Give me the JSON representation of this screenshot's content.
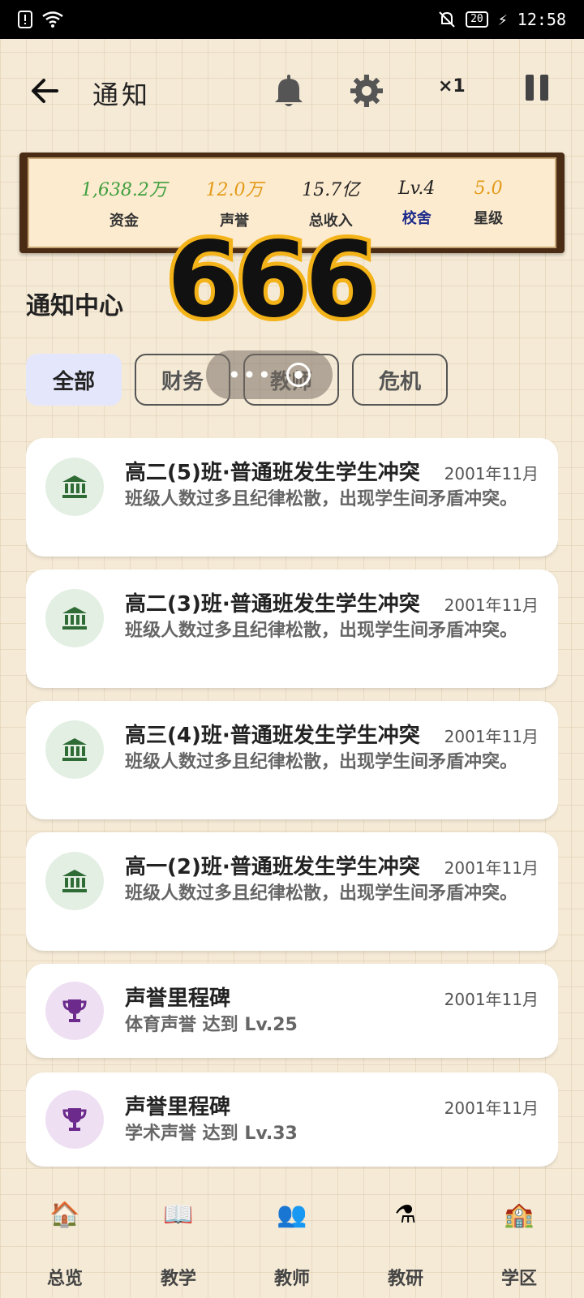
{
  "status_bar": {
    "time": "12:58",
    "battery": "20"
  },
  "app_bar": {
    "title": "通知",
    "speed": "×1"
  },
  "stats": [
    {
      "value": "1,638.2万",
      "label": "资金",
      "value_color": "#3e9f3e",
      "label_color": "#333333"
    },
    {
      "value": "12.0万",
      "label": "声誉",
      "value_color": "#e39a17",
      "label_color": "#333333"
    },
    {
      "value": "15.7亿",
      "label": "总收入",
      "value_color": "#222222",
      "label_color": "#333333"
    },
    {
      "value": "Lv.4",
      "label": "校舍",
      "value_color": "#222222",
      "label_color": "#1b2a8a"
    },
    {
      "value": "5.0",
      "label": "星级",
      "value_color": "#e39a17",
      "label_color": "#333333"
    }
  ],
  "overlay_number": "666",
  "section_title": "通知中心",
  "filters": [
    "全部",
    "财务",
    "教师",
    "危机"
  ],
  "notifications": [
    {
      "icon": "bank-icon",
      "title": "高二(5)班·普通班发生学生冲突",
      "date": "2001年11月",
      "desc": "班级人数过多且纪律松散，出现学生间矛盾冲突。"
    },
    {
      "icon": "bank-icon",
      "title": "高二(3)班·普通班发生学生冲突",
      "date": "2001年11月",
      "desc": "班级人数过多且纪律松散，出现学生间矛盾冲突。"
    },
    {
      "icon": "bank-icon",
      "title": "高三(4)班·普通班发生学生冲突",
      "date": "2001年11月",
      "desc": "班级人数过多且纪律松散，出现学生间矛盾冲突。"
    },
    {
      "icon": "bank-icon",
      "title": "高一(2)班·普通班发生学生冲突",
      "date": "2001年11月",
      "desc": "班级人数过多且纪律松散，出现学生间矛盾冲突。"
    },
    {
      "icon": "trophy-icon",
      "title": "声誉里程碑",
      "date": "2001年11月",
      "desc": "体育声誉 达到 Lv.25"
    },
    {
      "icon": "trophy-icon",
      "title": "声誉里程碑",
      "date": "2001年11月",
      "desc": "学术声誉 达到 Lv.33"
    }
  ],
  "nav": [
    {
      "label": "总览",
      "icon": "house-icon"
    },
    {
      "label": "教学",
      "icon": "book-icon"
    },
    {
      "label": "教师",
      "icon": "teachers-icon"
    },
    {
      "label": "教研",
      "icon": "flask-icon"
    },
    {
      "label": "学区",
      "icon": "school-icon"
    }
  ]
}
